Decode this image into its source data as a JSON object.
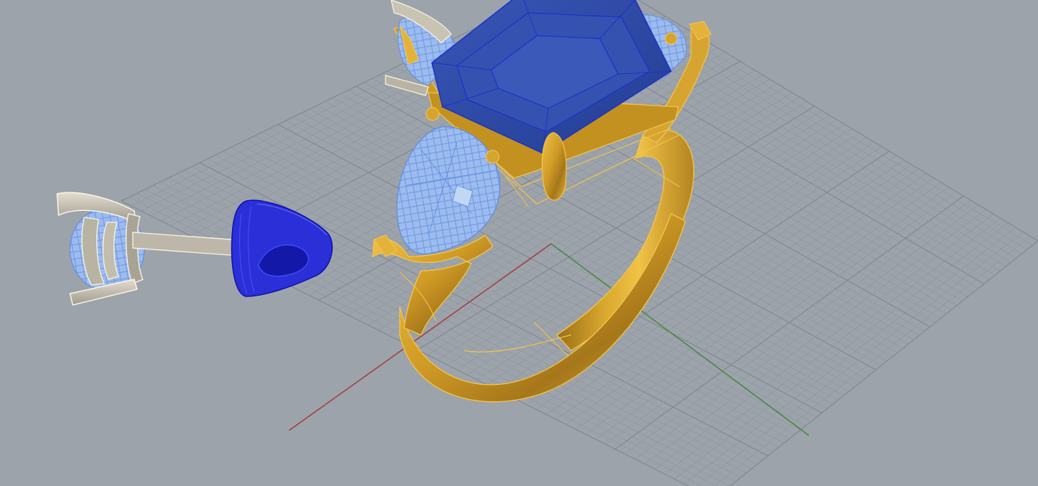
{
  "viewport": {
    "view": "perspective",
    "background_color": "#9da3aa",
    "grid": true,
    "grid_color": "#8d949b",
    "grid_major_color": "#7f868d",
    "x_axis_color": "#a23b3b",
    "y_axis_color": "#3f8a3f"
  },
  "objects": [
    {
      "name": "solitaire-ring",
      "material": "yellow-gold",
      "color": "#d8a52c",
      "edge_color": "#f2c34a"
    },
    {
      "name": "center-stone",
      "cut": "asscher",
      "color": "#2e4aa6",
      "edge_color": "#1b33c8"
    },
    {
      "name": "pear-side-stone",
      "color": "#94b6ee",
      "edge_color": "#5f8ee0"
    },
    {
      "name": "stud-earring-setting",
      "material": "white-gold",
      "color": "#c9c3b4",
      "edge_color": "#fbf6e6"
    },
    {
      "name": "earring-back",
      "color": "#2a2fd8",
      "edge_color": "#0d10a8"
    }
  ]
}
